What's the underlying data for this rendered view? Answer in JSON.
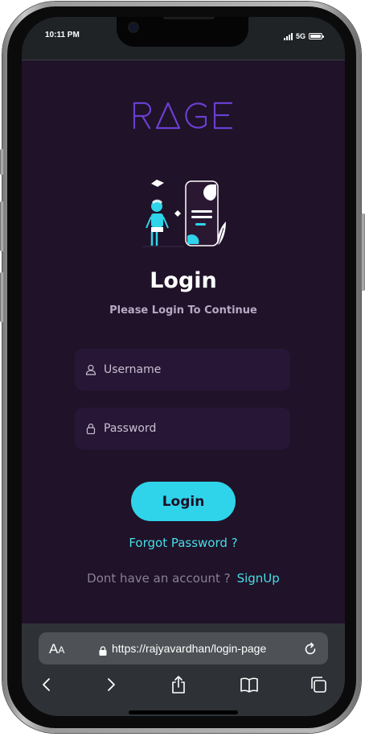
{
  "status_bar": {
    "time": "10:11 PM",
    "network": "5G"
  },
  "app": {
    "logo_text": "RAGE",
    "title": "Login",
    "subtitle": "Please Login To Continue",
    "username_placeholder": "Username",
    "password_placeholder": "Password",
    "login_button": "Login",
    "forgot_password": "Forgot Password ?",
    "signup_prompt": "Dont have an account ?",
    "signup_link": "SignUp"
  },
  "browser": {
    "text_size_label": "AA",
    "url": "https://rajyavardhan/login-page"
  },
  "colors": {
    "background": "#201228",
    "accent": "#2fd4ea",
    "logo": "#6a3fd0",
    "input_bg": "#281636"
  },
  "icons": [
    "user-icon",
    "lock-icon",
    "secure-lock-icon",
    "reload-icon",
    "back-icon",
    "forward-icon",
    "share-icon",
    "bookmarks-icon",
    "tabs-icon"
  ]
}
